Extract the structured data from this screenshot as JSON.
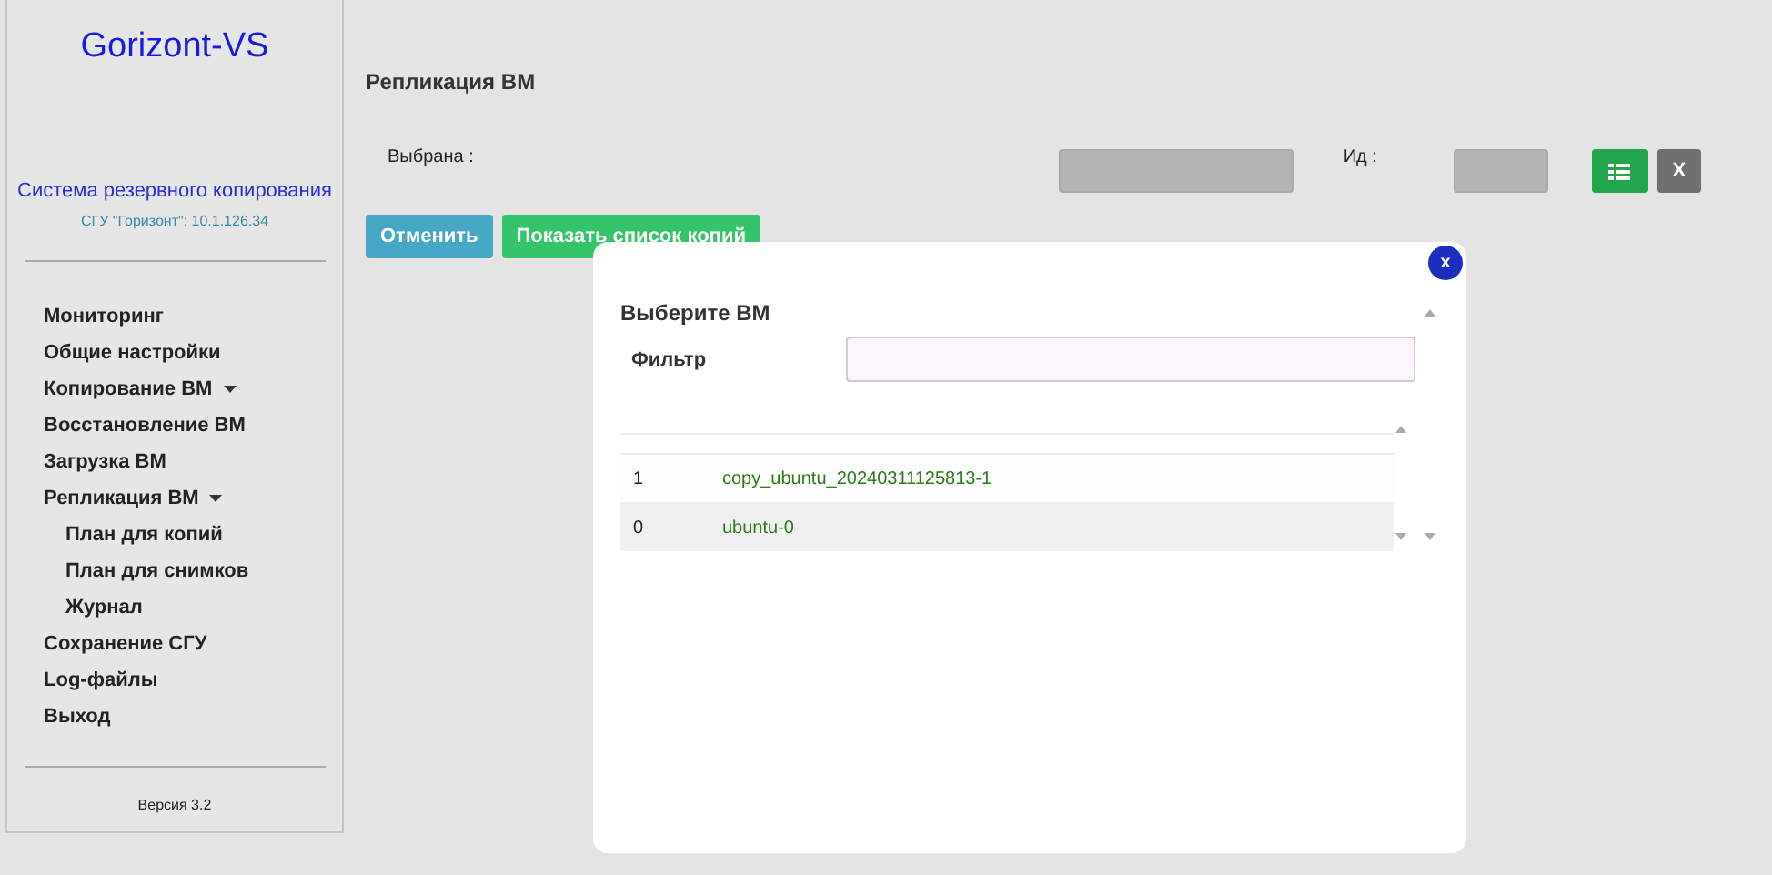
{
  "sidebar": {
    "logo": "Gorizont-VS",
    "subtitle": "Система резервного копирования",
    "host": "СГУ \"Горизонт\": 10.1.126.34",
    "items": [
      {
        "label": "Мониторинг",
        "kind": "link"
      },
      {
        "label": "Общие настройки",
        "kind": "link"
      },
      {
        "label": "Копирование ВМ",
        "kind": "dropdown"
      },
      {
        "label": "Восстановление ВМ",
        "kind": "link"
      },
      {
        "label": "Загрузка ВМ",
        "kind": "link"
      },
      {
        "label": "Репликация ВМ",
        "kind": "dropdown",
        "children": [
          {
            "label": "План для копий"
          },
          {
            "label": "План для снимков"
          },
          {
            "label": "Журнал"
          }
        ]
      },
      {
        "label": "Сохранение СГУ",
        "kind": "link"
      },
      {
        "label": "Log-файлы",
        "kind": "link"
      },
      {
        "label": "Выход",
        "kind": "link"
      }
    ],
    "version": "Версия 3.2"
  },
  "main": {
    "title": "Репликация ВМ",
    "selected_label": "Выбрана :",
    "id_label": "Ид :",
    "clear_button": "X",
    "buttons": [
      "Отменить",
      "Показать список копий"
    ]
  },
  "dialog": {
    "close": "x",
    "title": "Выберите ВМ",
    "filter_label": "Фильтр",
    "rows": [
      {
        "number": "1",
        "name": "copy_ubuntu_20240311125813-1"
      },
      {
        "number": "0",
        "name": "ubuntu-0"
      }
    ]
  }
}
